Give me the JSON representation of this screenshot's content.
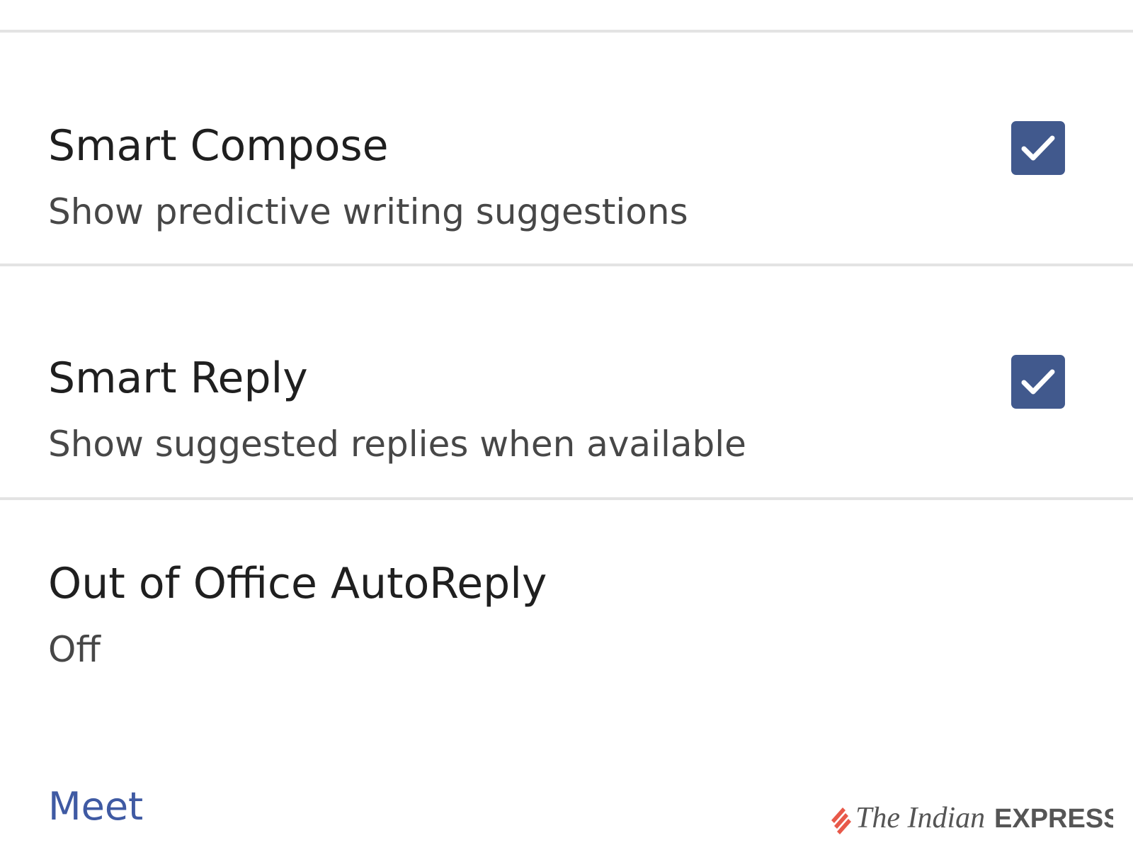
{
  "settings": [
    {
      "title": "Smart Compose",
      "subtitle": "Show predictive writing suggestions",
      "checked": true
    },
    {
      "title": "Smart Reply",
      "subtitle": "Show suggested replies when available",
      "checked": true
    },
    {
      "title": "Out of Office AutoReply",
      "subtitle": "Off"
    }
  ],
  "section_header": "Meet",
  "watermark": {
    "brand_part1": "The Indian",
    "brand_part2": "EXPRESS"
  },
  "colors": {
    "checkbox": "#41598d",
    "section_header": "#3f5aa3",
    "watermark_mark": "#e8594a",
    "divider": "#e3e3e3"
  }
}
